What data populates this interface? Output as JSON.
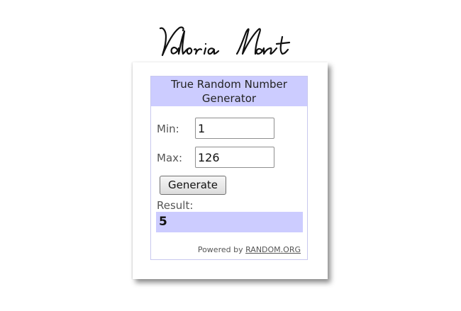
{
  "signature": {
    "text": "Valoria Mant"
  },
  "widget": {
    "title": "True Random Number Generator",
    "min_label": "Min:",
    "min_value": "1",
    "max_label": "Max:",
    "max_value": "126",
    "generate_label": "Generate",
    "result_label": "Result:",
    "result_value": "5",
    "powered_by_text": "Powered by",
    "powered_by_link": "RANDOM.ORG"
  },
  "colors": {
    "header_bg": "#ccccff",
    "result_bg": "#ccccff",
    "widget_border": "#c8c8ee"
  }
}
